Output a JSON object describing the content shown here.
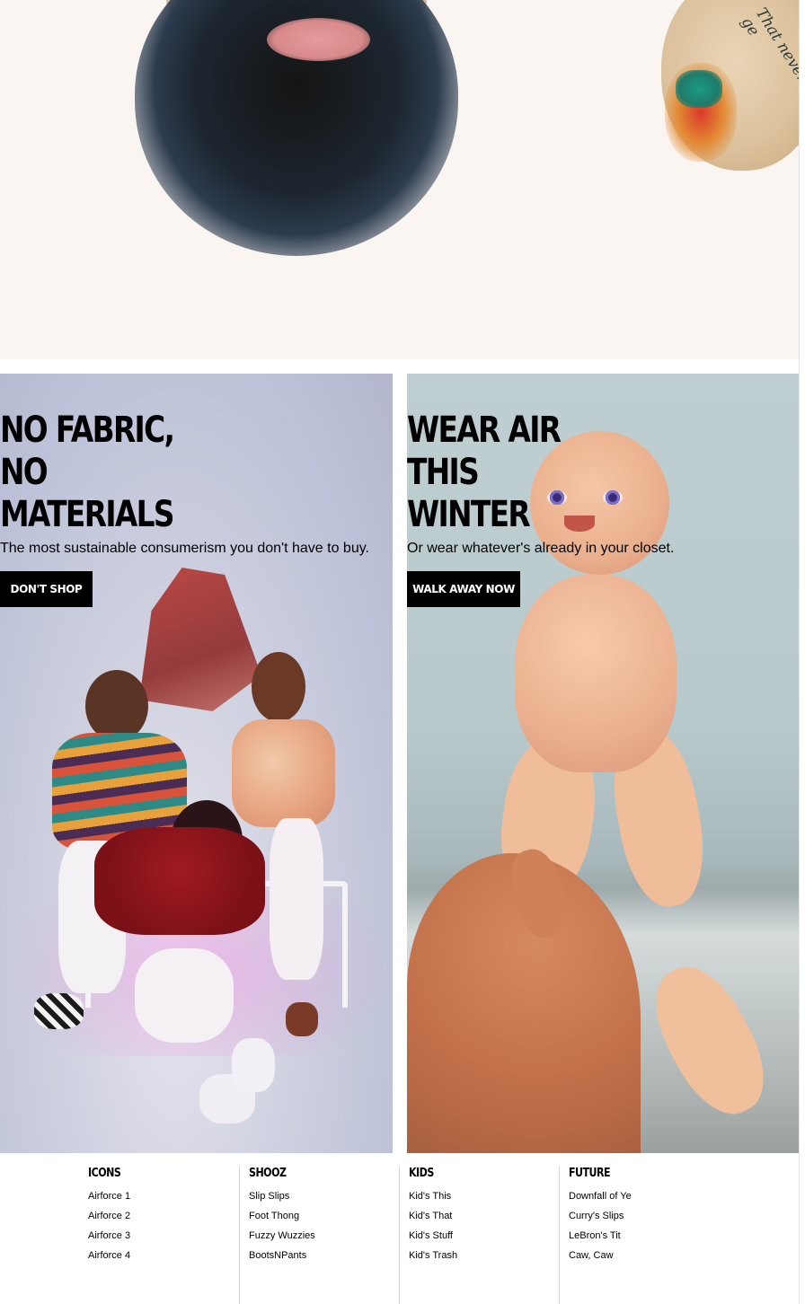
{
  "hero": {
    "tattoo_text": "That never ge"
  },
  "panels": [
    {
      "headline": [
        "NO FABRIC,",
        "NO",
        "MATERIALS"
      ],
      "subtext": "The most sustainable consumerism you don't have to buy.",
      "cta": "DON'T SHOP"
    },
    {
      "headline": [
        "WEAR AIR",
        "THIS",
        "WINTER"
      ],
      "subtext": "Or wear whatever's already in your closet.",
      "cta": "WALK AWAY NOW"
    }
  ],
  "footer": {
    "columns": [
      {
        "title": "ICONS",
        "links": [
          "Airforce 1",
          "Airforce 2",
          "Airforce 3",
          "Airforce 4"
        ]
      },
      {
        "title": "SHOOZ",
        "links": [
          "Slip Slips",
          "Foot Thong",
          "Fuzzy Wuzzies",
          "BootsNPants"
        ]
      },
      {
        "title": "KIDS",
        "links": [
          "Kid's This",
          "Kid's That",
          "Kid's Stuff",
          "Kid's Trash"
        ]
      },
      {
        "title": "FUTURE",
        "links": [
          "Downfall of Ye",
          "Curry's Slips",
          "LeBron's Tit",
          "Caw, Caw"
        ]
      }
    ]
  },
  "colors": {
    "cta_background": "#000000",
    "cta_text": "#ffffff",
    "divider": "#d4d4d4"
  }
}
